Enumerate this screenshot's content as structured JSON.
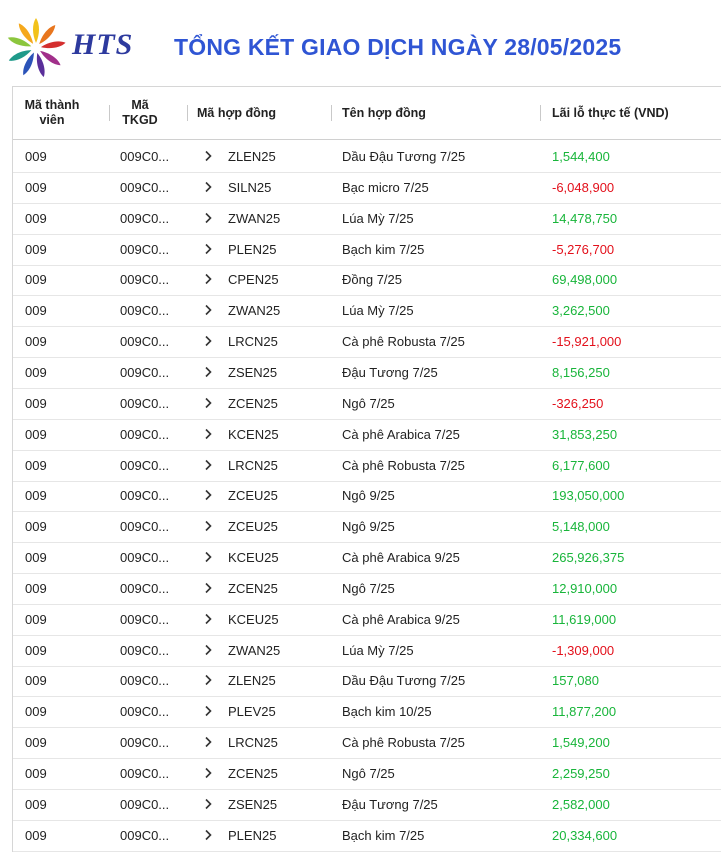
{
  "header": {
    "brand": "HTS",
    "title": "TỔNG KẾT GIAO DỊCH NGÀY 28/05/2025",
    "logo_icon": "sunburst-logo-icon"
  },
  "table": {
    "columns": {
      "member": "Mã thành viên",
      "account": "Mã TKGD",
      "contract_code": "Mã hợp đồng",
      "contract_name": "Tên hợp đồng",
      "pnl": "Lãi lỗ thực tế (VND)"
    },
    "expand_icon": "chevron-right-icon",
    "colors": {
      "positive": "#18b53a",
      "negative": "#e3101b"
    },
    "rows": [
      {
        "member": "009",
        "account": "009C0...",
        "code": "ZLEN25",
        "name": "Dầu Đậu Tương 7/25",
        "pnl": "1,544,400",
        "sign": "pos"
      },
      {
        "member": "009",
        "account": "009C0...",
        "code": "SILN25",
        "name": "Bạc micro 7/25",
        "pnl": "-6,048,900",
        "sign": "neg"
      },
      {
        "member": "009",
        "account": "009C0...",
        "code": "ZWAN25",
        "name": "Lúa Mỳ 7/25",
        "pnl": "14,478,750",
        "sign": "pos"
      },
      {
        "member": "009",
        "account": "009C0...",
        "code": "PLEN25",
        "name": "Bạch kim 7/25",
        "pnl": "-5,276,700",
        "sign": "neg"
      },
      {
        "member": "009",
        "account": "009C0...",
        "code": "CPEN25",
        "name": "Đồng 7/25",
        "pnl": "69,498,000",
        "sign": "pos"
      },
      {
        "member": "009",
        "account": "009C0...",
        "code": "ZWAN25",
        "name": "Lúa Mỳ 7/25",
        "pnl": "3,262,500",
        "sign": "pos"
      },
      {
        "member": "009",
        "account": "009C0...",
        "code": "LRCN25",
        "name": "Cà phê Robusta 7/25",
        "pnl": "-15,921,000",
        "sign": "neg"
      },
      {
        "member": "009",
        "account": "009C0...",
        "code": "ZSEN25",
        "name": "Đậu Tương 7/25",
        "pnl": "8,156,250",
        "sign": "pos"
      },
      {
        "member": "009",
        "account": "009C0...",
        "code": "ZCEN25",
        "name": "Ngô 7/25",
        "pnl": "-326,250",
        "sign": "neg"
      },
      {
        "member": "009",
        "account": "009C0...",
        "code": "KCEN25",
        "name": "Cà phê Arabica 7/25",
        "pnl": "31,853,250",
        "sign": "pos"
      },
      {
        "member": "009",
        "account": "009C0...",
        "code": "LRCN25",
        "name": "Cà phê Robusta 7/25",
        "pnl": "6,177,600",
        "sign": "pos"
      },
      {
        "member": "009",
        "account": "009C0...",
        "code": "ZCEU25",
        "name": "Ngô 9/25",
        "pnl": "193,050,000",
        "sign": "pos"
      },
      {
        "member": "009",
        "account": "009C0...",
        "code": "ZCEU25",
        "name": "Ngô 9/25",
        "pnl": "5,148,000",
        "sign": "pos"
      },
      {
        "member": "009",
        "account": "009C0...",
        "code": "KCEU25",
        "name": "Cà phê Arabica 9/25",
        "pnl": "265,926,375",
        "sign": "pos"
      },
      {
        "member": "009",
        "account": "009C0...",
        "code": "ZCEN25",
        "name": "Ngô 7/25",
        "pnl": "12,910,000",
        "sign": "pos"
      },
      {
        "member": "009",
        "account": "009C0...",
        "code": "KCEU25",
        "name": "Cà phê Arabica 9/25",
        "pnl": "11,619,000",
        "sign": "pos"
      },
      {
        "member": "009",
        "account": "009C0...",
        "code": "ZWAN25",
        "name": "Lúa Mỳ 7/25",
        "pnl": "-1,309,000",
        "sign": "neg"
      },
      {
        "member": "009",
        "account": "009C0...",
        "code": "ZLEN25",
        "name": "Dầu Đậu Tương 7/25",
        "pnl": "157,080",
        "sign": "pos"
      },
      {
        "member": "009",
        "account": "009C0...",
        "code": "PLEV25",
        "name": "Bạch kim 10/25",
        "pnl": "11,877,200",
        "sign": "pos"
      },
      {
        "member": "009",
        "account": "009C0...",
        "code": "LRCN25",
        "name": "Cà phê Robusta 7/25",
        "pnl": "1,549,200",
        "sign": "pos"
      },
      {
        "member": "009",
        "account": "009C0...",
        "code": "ZCEN25",
        "name": "Ngô 7/25",
        "pnl": "2,259,250",
        "sign": "pos"
      },
      {
        "member": "009",
        "account": "009C0...",
        "code": "ZSEN25",
        "name": "Đậu Tương 7/25",
        "pnl": "2,582,000",
        "sign": "pos"
      },
      {
        "member": "009",
        "account": "009C0...",
        "code": "PLEN25",
        "name": "Bạch kim 7/25",
        "pnl": "20,334,600",
        "sign": "pos"
      }
    ]
  }
}
